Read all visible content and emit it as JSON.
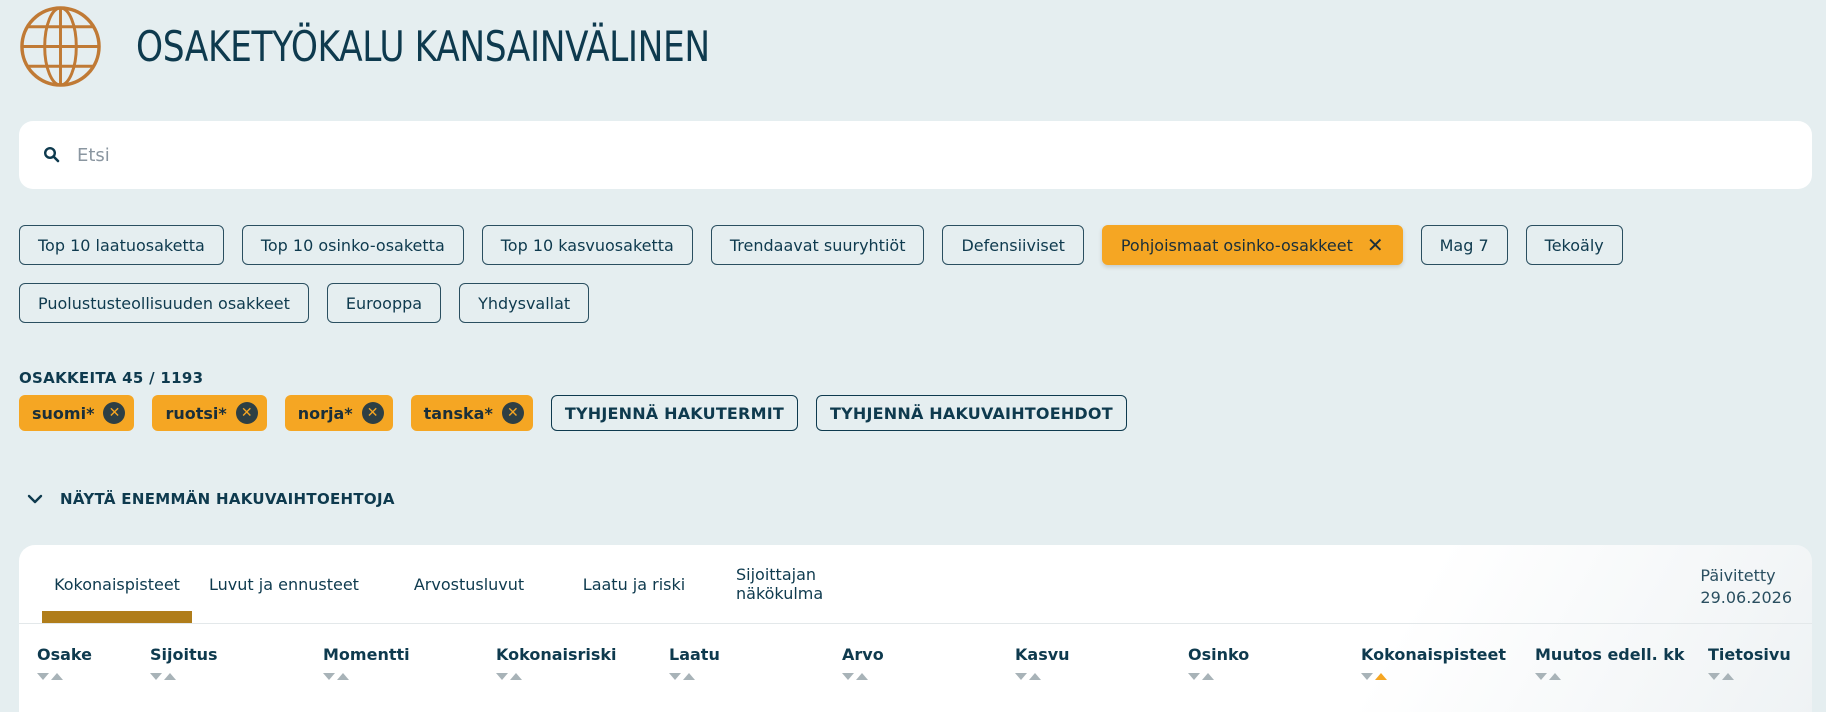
{
  "app": {
    "title": "OSAKETYÖKALU KANSAINVÄLINEN"
  },
  "search": {
    "placeholder": "Etsi"
  },
  "presets": {
    "row1": [
      {
        "label": "Top 10 laatuosaketta",
        "active": false
      },
      {
        "label": "Top 10 osinko-osaketta",
        "active": false
      },
      {
        "label": "Top 10 kasvuosaketta",
        "active": false
      },
      {
        "label": "Trendaavat suuryhtiöt",
        "active": false
      },
      {
        "label": "Defensiiviset",
        "active": false
      },
      {
        "label": "Pohjoismaat osinko-osakkeet",
        "active": true
      },
      {
        "label": "Mag 7",
        "active": false
      },
      {
        "label": "Tekoäly",
        "active": false
      }
    ],
    "row2": [
      {
        "label": "Puolustusteollisuuden osakkeet",
        "active": false
      },
      {
        "label": "Eurooppa",
        "active": false
      },
      {
        "label": "Yhdysvallat",
        "active": false
      }
    ],
    "active_close": "✕"
  },
  "results": {
    "count_label": "OSAKKEITA 45 / 1193"
  },
  "search_terms": [
    "suomi*",
    "ruotsi*",
    "norja*",
    "tanska*"
  ],
  "actions": {
    "clear_terms": "TYHJENNÄ HAKUTERMIT",
    "clear_options": "TYHJENNÄ HAKUVAIHTOEHDOT",
    "show_more": "NÄYTÄ ENEMMÄN HAKUVAIHTOEHTOJA"
  },
  "tabs": [
    "Kokonaispisteet",
    "Luvut ja ennusteet",
    "Arvostusluvut",
    "Laatu ja riski",
    "Sijoittajan näkökulma"
  ],
  "updated": {
    "label": "Päivitetty",
    "date": "29.06.2026"
  },
  "columns": [
    "Osake",
    "Sijoitus",
    "Momentti",
    "Kokonaisriski",
    "Laatu",
    "Arvo",
    "Kasvu",
    "Osinko",
    "Kokonaispisteet",
    "Muutos edell. kk",
    "Tietosivu"
  ],
  "colors": {
    "accent": "#f5a623",
    "primary": "#0e3a4e",
    "background": "#e5eef0",
    "tab_indicator": "#b07d1a",
    "logo": "#c07a35"
  }
}
